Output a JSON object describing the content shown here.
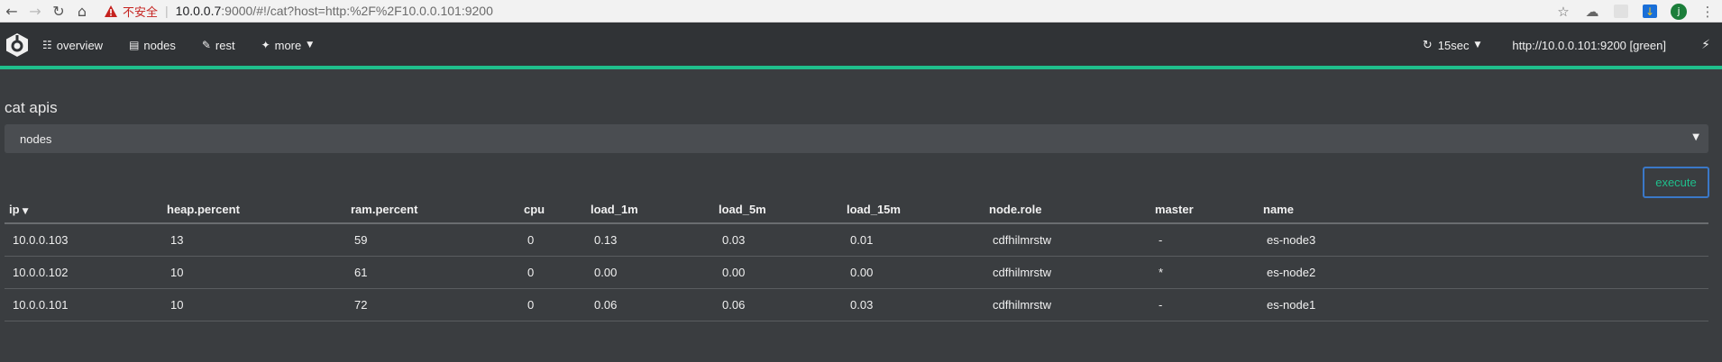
{
  "browser": {
    "insecure_label": "不安全",
    "url_host": "10.0.0.7",
    "url_rest": ":9000/#!/cat?host=http:%2F%2F10.0.0.101:9200",
    "profile_initial": "j"
  },
  "navbar": {
    "items": [
      {
        "label": "overview",
        "icon": "sitemap-icon"
      },
      {
        "label": "nodes",
        "icon": "server-icon"
      },
      {
        "label": "rest",
        "icon": "edit-icon"
      },
      {
        "label": "more",
        "icon": "magic-wand-icon"
      }
    ],
    "refresh_label": "15sec",
    "cluster_label": "http://10.0.0.101:9200 [green]"
  },
  "colors": {
    "accent": "#1fbf8c",
    "button_border": "#3a78c8",
    "background": "#3a3d40",
    "navbar": "#303336"
  },
  "main": {
    "title": "cat apis",
    "selected_api": "nodes",
    "execute_label": "execute"
  },
  "table": {
    "columns": [
      "ip",
      "heap.percent",
      "ram.percent",
      "cpu",
      "load_1m",
      "load_5m",
      "load_15m",
      "node.role",
      "master",
      "name"
    ],
    "rows": [
      [
        "10.0.0.103",
        "13",
        "59",
        "0",
        "0.13",
        "0.03",
        "0.01",
        "cdfhilmrstw",
        "-",
        "es-node3"
      ],
      [
        "10.0.0.102",
        "10",
        "61",
        "0",
        "0.00",
        "0.00",
        "0.00",
        "cdfhilmrstw",
        "*",
        "es-node2"
      ],
      [
        "10.0.0.101",
        "10",
        "72",
        "0",
        "0.06",
        "0.06",
        "0.03",
        "cdfhilmrstw",
        "-",
        "es-node1"
      ]
    ]
  }
}
